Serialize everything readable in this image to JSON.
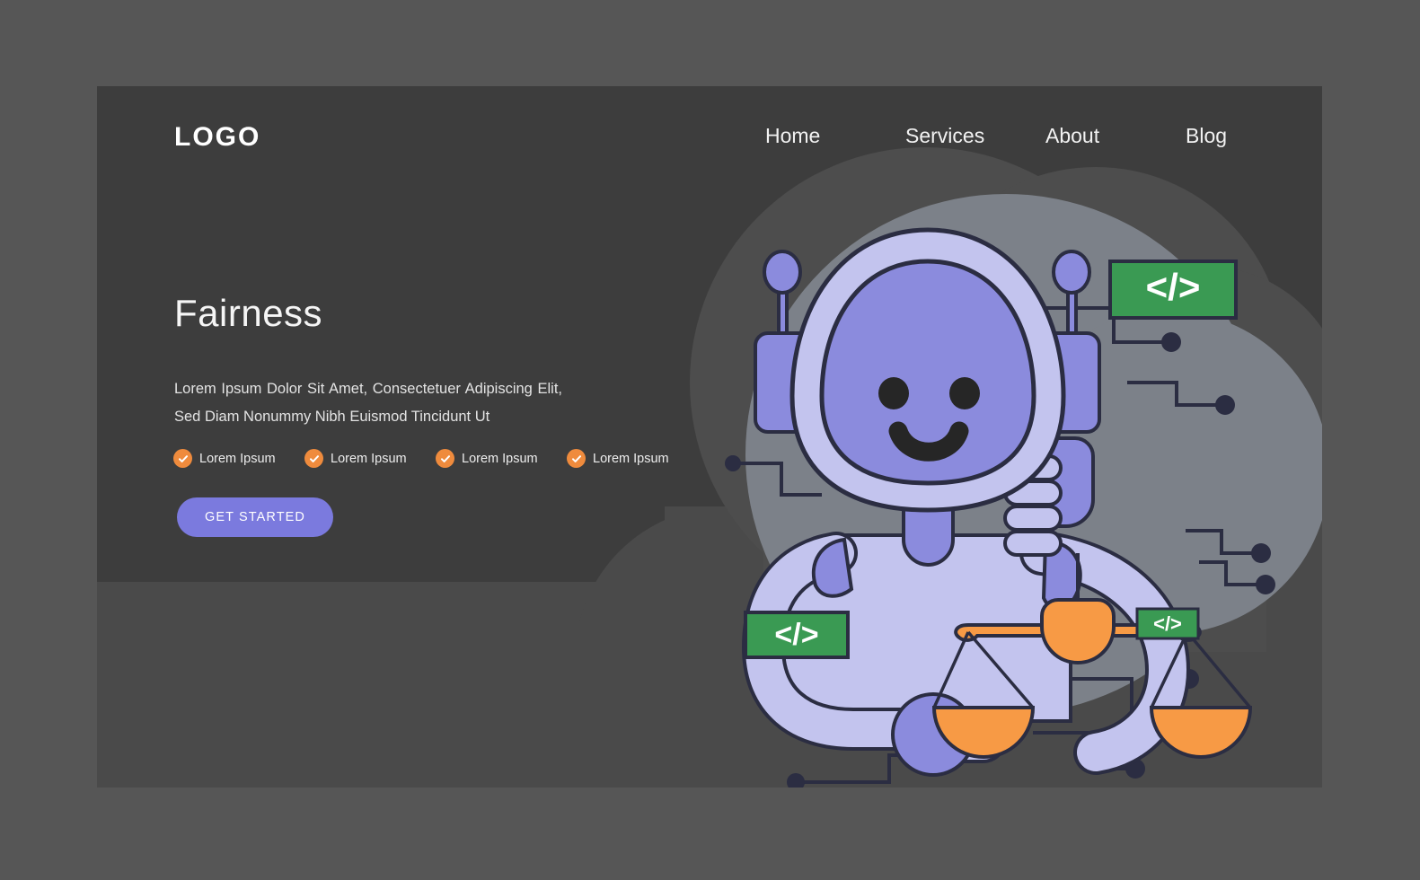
{
  "page": {
    "background_color": "#565656",
    "card_color": "#3d3d3d"
  },
  "header": {
    "logo": "LOGO",
    "nav": [
      {
        "label": "Home"
      },
      {
        "label": "Services"
      },
      {
        "label": "About"
      },
      {
        "label": "Blog"
      }
    ]
  },
  "hero": {
    "title": "Fairness",
    "description": "Lorem Ipsum Dolor Sit Amet, Consectetuer Adipiscing Elit, Sed Diam Nonummy Nibh Euismod Tincidunt Ut",
    "features": [
      {
        "label": "Lorem Ipsum",
        "icon": "check-circle-icon"
      },
      {
        "label": "Lorem Ipsum",
        "icon": "check-circle-icon"
      },
      {
        "label": "Lorem Ipsum",
        "icon": "check-circle-icon"
      },
      {
        "label": "Lorem Ipsum",
        "icon": "check-circle-icon"
      }
    ],
    "cta_label": "GET STARTED"
  },
  "illustration": {
    "description": "Friendly purple robot giving a thumbs up while holding the scales of justice",
    "code_badges": [
      {
        "label": "</>",
        "size": "large"
      },
      {
        "label": "</>",
        "size": "medium"
      },
      {
        "label": "</>",
        "size": "small"
      }
    ],
    "colors": {
      "accent_purple": "#7b7ade",
      "light_purple": "#c3c4ee",
      "orange": "#f79a45",
      "check_orange": "#ef8b3d",
      "badge_green": "#3a9a53",
      "outline": "#2b2d42",
      "blob_light": "#7c8189",
      "blob_dark": "#4d4d4d"
    }
  }
}
